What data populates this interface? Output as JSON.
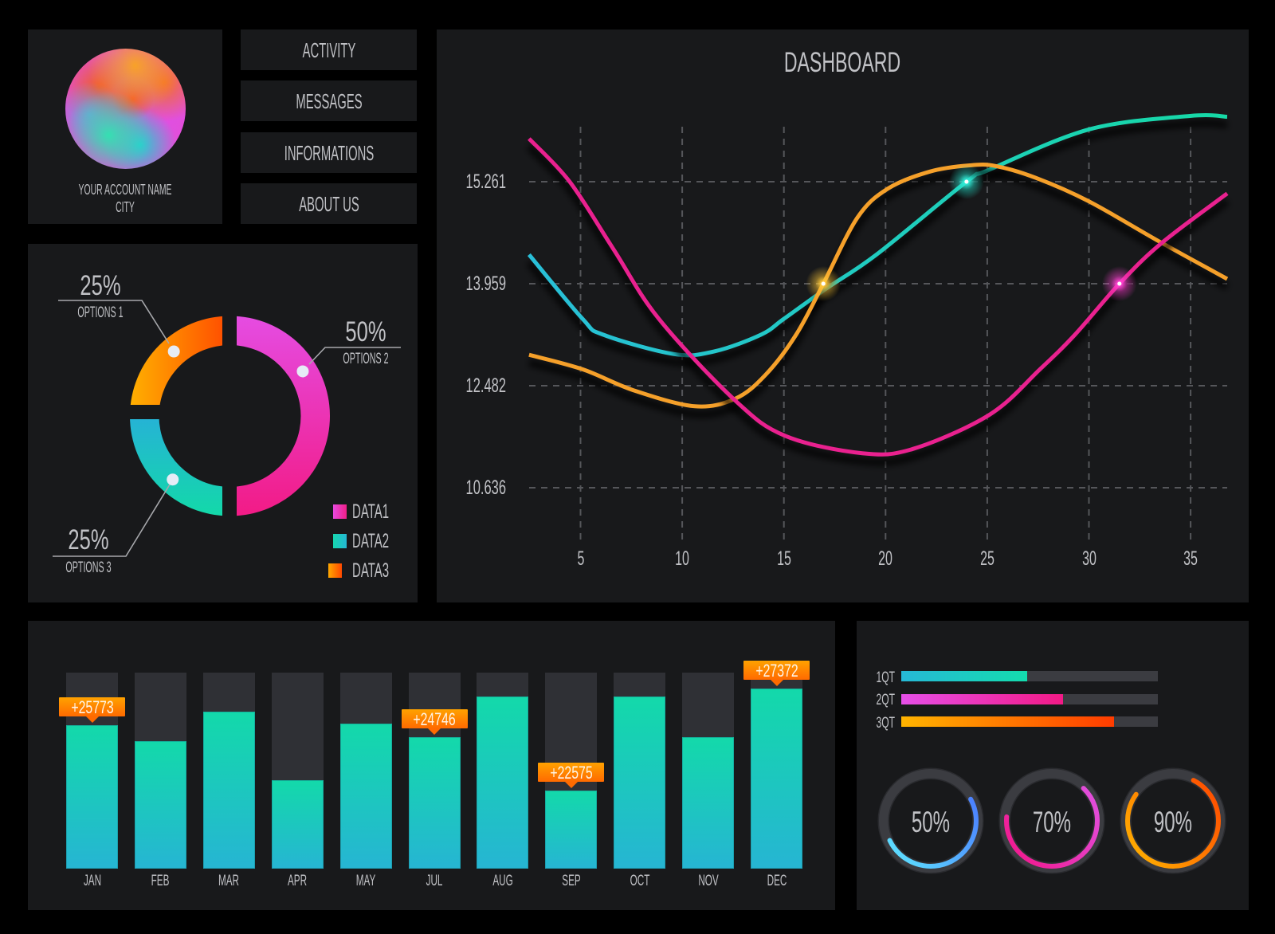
{
  "profile": {
    "account_name": "YOUR ACCOUNT NAME",
    "city": "CITY"
  },
  "nav": {
    "items": [
      {
        "label": "ACTIVITY"
      },
      {
        "label": "MESSAGES"
      },
      {
        "label": "INFORMATIONS"
      },
      {
        "label": "ABOUT US"
      }
    ]
  },
  "theme": {
    "page_background": "#000000",
    "panel_background": "#18191b",
    "text": "#c0c1c5",
    "grid": "#55565a",
    "bar_track": "#2f3035",
    "progress_track": "#3b3c41"
  },
  "chart_data": [
    {
      "id": "options-donut",
      "type": "pie",
      "donut": true,
      "slices": [
        {
          "label": "OPTIONS 2",
          "value": 50,
          "value_label": "50%",
          "legend": "DATA1",
          "colors": [
            "#e54ce2",
            "#f21b86"
          ]
        },
        {
          "label": "OPTIONS 3",
          "value": 25,
          "value_label": "25%",
          "legend": "DATA2",
          "colors": [
            "#26b2d6",
            "#13d9a9"
          ]
        },
        {
          "label": "OPTIONS 1",
          "value": 25,
          "value_label": "25%",
          "legend": "DATA3",
          "colors": [
            "#ffb000",
            "#ff4a00"
          ]
        }
      ],
      "legend": [
        {
          "label": "DATA1",
          "colors": [
            "#e84ae0",
            "#f01f88"
          ]
        },
        {
          "label": "DATA2",
          "colors": [
            "#16d6ae",
            "#24b8d4"
          ]
        },
        {
          "label": "DATA3",
          "colors": [
            "#ffa800",
            "#ff4800"
          ]
        }
      ],
      "legend_position": "bottom-right"
    },
    {
      "id": "dashboard-line",
      "type": "line",
      "title": "DASHBOARD",
      "xlabel": "",
      "ylabel": "",
      "x_ticks": [
        5,
        10,
        15,
        20,
        25,
        30,
        35
      ],
      "y_ticks": [
        15.261,
        13.959,
        12.482,
        10.636
      ],
      "xlim": [
        2.5,
        36.8
      ],
      "grid": true,
      "grid_style": "dashed",
      "series": [
        {
          "name": "teal",
          "colors": [
            "#29bfd8",
            "#16d9a6"
          ],
          "points": [
            [
              2.47,
              14.33
            ],
            [
              5.1,
              13.45
            ],
            [
              6.12,
              13.22
            ],
            [
              9.6,
              12.94
            ],
            [
              11.6,
              12.98
            ],
            [
              13.87,
              13.22
            ],
            [
              15.0,
              13.45
            ],
            [
              17.09,
              13.89
            ],
            [
              19.55,
              14.33
            ],
            [
              23.98,
              15.261
            ],
            [
              25.06,
              15.41
            ],
            [
              30.03,
              15.93
            ],
            [
              34.97,
              16.1
            ],
            [
              36.8,
              16.09
            ]
          ]
        },
        {
          "name": "orange",
          "colors": [
            "#f5a02a"
          ],
          "points": [
            [
              2.47,
              12.93
            ],
            [
              5.1,
              12.72
            ],
            [
              7.6,
              12.4
            ],
            [
              10.62,
              12.11
            ],
            [
              12.62,
              12.25
            ],
            [
              14.1,
              12.64
            ],
            [
              15.6,
              13.22
            ],
            [
              16.94,
              13.959
            ],
            [
              18.61,
              14.8
            ],
            [
              20.1,
              15.17
            ],
            [
              22.18,
              15.39
            ],
            [
              24.14,
              15.47
            ],
            [
              25.43,
              15.46
            ],
            [
              27.39,
              15.31
            ],
            [
              30.0,
              15.01
            ],
            [
              33.58,
              14.48
            ],
            [
              36.8,
              14.02
            ]
          ]
        },
        {
          "name": "pink",
          "colors": [
            "#e9218f"
          ],
          "points": [
            [
              2.47,
              15.81
            ],
            [
              4.47,
              15.26
            ],
            [
              6.62,
              14.4
            ],
            [
              8.85,
              13.45
            ],
            [
              12.62,
              12.21
            ],
            [
              15.09,
              11.57
            ],
            [
              18.85,
              11.26
            ],
            [
              21.36,
              11.34
            ],
            [
              25.12,
              11.96
            ],
            [
              27.59,
              12.72
            ],
            [
              29.31,
              13.22
            ],
            [
              31.5,
              13.959
            ],
            [
              33.58,
              14.48
            ],
            [
              36.8,
              15.11
            ]
          ]
        }
      ],
      "highlights": [
        {
          "series": "orange",
          "x": 16.94,
          "y": 13.959,
          "glow": "#ffc93a"
        },
        {
          "series": "teal",
          "x": 23.98,
          "y": 15.261,
          "glow": "#30ecd8"
        },
        {
          "series": "pink",
          "x": 31.5,
          "y": 13.959,
          "glow": "#ff42d2"
        }
      ]
    },
    {
      "id": "monthly-bars",
      "type": "bar",
      "categories": [
        "JAN",
        "FEB",
        "MAR",
        "APR",
        "MAY",
        "JUL",
        "AUG",
        "SEP",
        "OCT",
        "NOV",
        "DEC"
      ],
      "values": [
        0.73,
        0.65,
        0.8,
        0.45,
        0.74,
        0.67,
        0.88,
        0.4,
        0.88,
        0.67,
        0.92
      ],
      "value_unit": "fraction of full bar",
      "ylim": [
        0,
        1
      ],
      "colors": [
        "#13d9aa",
        "#26b5d3"
      ],
      "callouts": [
        {
          "category": "JAN",
          "label": "+25773"
        },
        {
          "category": "JUL",
          "label": "+24746"
        },
        {
          "category": "SEP",
          "label": "+22575"
        },
        {
          "category": "DEC",
          "label": "+27372"
        }
      ],
      "callout_colors": [
        "#ffa200",
        "#ff6a00"
      ]
    },
    {
      "id": "quarter-progress",
      "type": "bar",
      "orientation": "horizontal",
      "categories": [
        "1QT",
        "2QT",
        "3QT"
      ],
      "values": [
        0.49,
        0.63,
        0.83
      ],
      "colors": [
        [
          "#26b8d6",
          "#14dcae"
        ],
        [
          "#e64fe8",
          "#f21a86"
        ],
        [
          "#ffb400",
          "#ff3c00"
        ]
      ]
    },
    {
      "id": "percent-rings",
      "type": "pie",
      "gauge": true,
      "values": [
        50,
        70,
        90
      ],
      "labels": [
        "50%",
        "70%",
        "90%"
      ],
      "colors": [
        [
          "#5ee6ff",
          "#4a78ff"
        ],
        [
          "#f2168a",
          "#e052e2"
        ],
        [
          "#ffb300",
          "#ff4a00"
        ]
      ]
    }
  ]
}
